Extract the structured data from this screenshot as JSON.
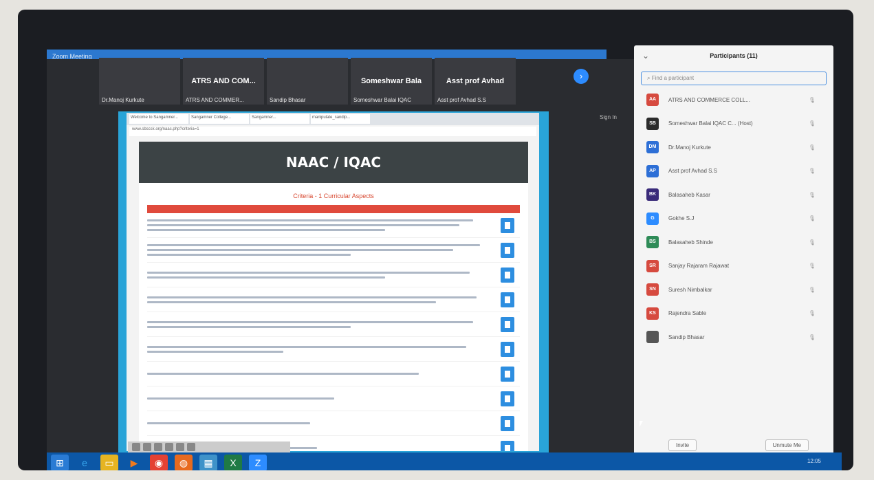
{
  "zoom": {
    "title": "Zoom Meeting",
    "sign_in": "Sign In",
    "gallery": [
      {
        "big": "",
        "name": "Dr.Manoj Kurkute"
      },
      {
        "big": "ATRS AND COM...",
        "name": "ATRS AND COMMER..."
      },
      {
        "big": "",
        "name": "Sandip Bhasar"
      },
      {
        "big": "Someshwar Bala",
        "name": "Someshwar Balai IQAC"
      },
      {
        "big": "Asst prof Avhad",
        "name": "Asst prof Avhad S.S"
      }
    ]
  },
  "browser": {
    "tabs": [
      "Welcome to Sangamner...",
      "Sangamner College...",
      "Sangamner...",
      "manipulate_sandip..."
    ],
    "address": "www.sbscsk.org/naac.php?criteria=1"
  },
  "site": {
    "header": "NAAC / IQAC",
    "criterion": "Criteria - 1 Curricular Aspects",
    "row_count": 10
  },
  "participants": {
    "title": "Participants (11)",
    "search_placeholder": "Find a participant",
    "list": [
      {
        "initials": "AA",
        "name": "ATRS AND COMMERCE COLL...",
        "color": "#d64a3f"
      },
      {
        "initials": "SB",
        "name": "Someshwar Balai IQAC C... (Host)",
        "color": "#2b2b2b"
      },
      {
        "initials": "DM",
        "name": "Dr.Manoj Kurkute",
        "color": "#2d6fd6"
      },
      {
        "initials": "AP",
        "name": "Asst prof Avhad S.S",
        "color": "#2d6fd6"
      },
      {
        "initials": "BK",
        "name": "Balasaheb Kasar",
        "color": "#3a2b7a"
      },
      {
        "initials": "G",
        "name": "Gokhe S.J",
        "color": "#2d8cff"
      },
      {
        "initials": "BS",
        "name": "Balasaheb Shinde",
        "color": "#2e8b57"
      },
      {
        "initials": "SR",
        "name": "Sanjay Rajaram Rajawat",
        "color": "#d64a3f"
      },
      {
        "initials": "SN",
        "name": "Suresh Nimbalkar",
        "color": "#d64a3f"
      },
      {
        "initials": "KS",
        "name": "Rajendra Sable",
        "color": "#d64a3f"
      },
      {
        "initials": "",
        "name": "Sandip Bhasar",
        "color": "#555555"
      }
    ],
    "invite_label": "Invite",
    "unmute_label": "Unmute Me"
  },
  "taskbar": {
    "clock": "12:05"
  }
}
